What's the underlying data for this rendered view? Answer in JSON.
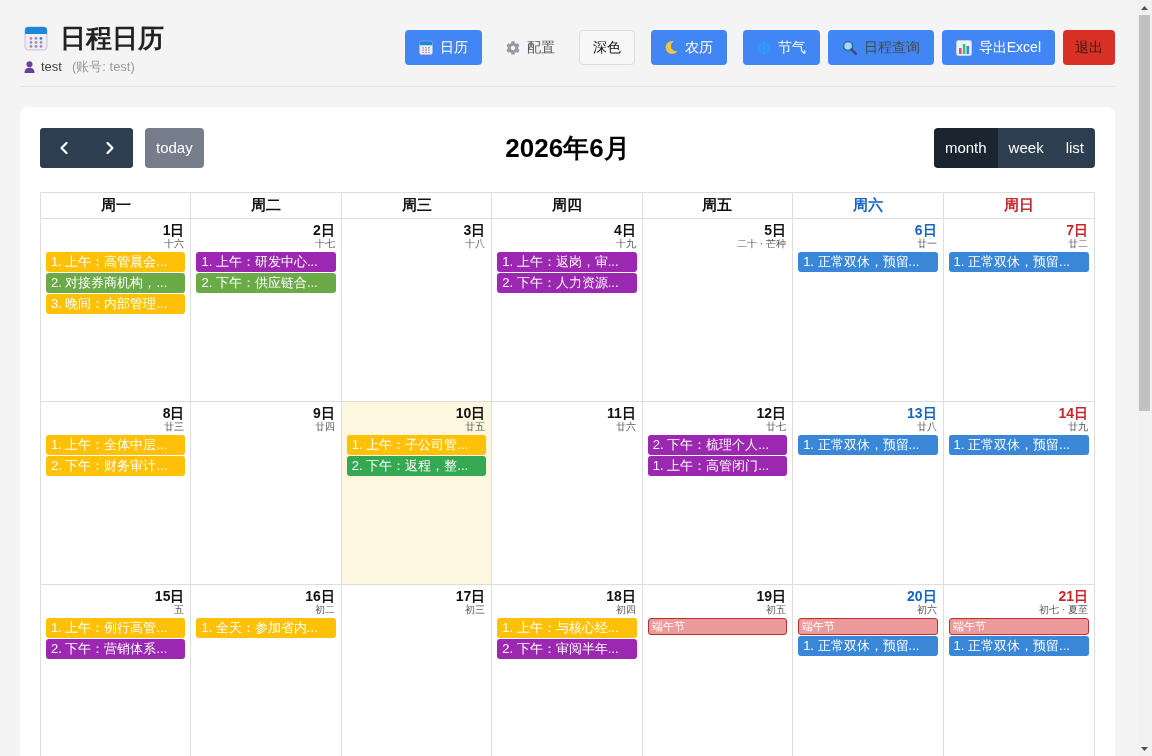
{
  "header": {
    "title": "日程日历",
    "user": "test",
    "account": "(账号: test)"
  },
  "toolbar_buttons": [
    {
      "label": "日历",
      "kind": "primary"
    },
    {
      "label": "配置",
      "kind": "plain"
    },
    {
      "label": "深色",
      "kind": "outline"
    },
    {
      "label": "农历",
      "kind": "primary"
    },
    {
      "label": "节气",
      "kind": "primary"
    },
    {
      "label": "日程查询",
      "kind": "muted"
    },
    {
      "label": "导出Excel",
      "kind": "primary"
    },
    {
      "label": "退出",
      "kind": "danger"
    }
  ],
  "calendar": {
    "today_button": "today",
    "title": "2026年6月",
    "views": [
      {
        "label": "month",
        "selected": true
      },
      {
        "label": "week",
        "selected": false
      },
      {
        "label": "list",
        "selected": false
      }
    ],
    "weekdays": [
      {
        "label": "周一",
        "kind": "weekday"
      },
      {
        "label": "周二",
        "kind": "weekday"
      },
      {
        "label": "周三",
        "kind": "weekday"
      },
      {
        "label": "周四",
        "kind": "weekday"
      },
      {
        "label": "周五",
        "kind": "weekday"
      },
      {
        "label": "周六",
        "kind": "saturday"
      },
      {
        "label": "周日",
        "kind": "sunday"
      }
    ],
    "weeks": [
      {
        "days": [
          {
            "date": "1日",
            "lunar": "十六",
            "kind": "weekday",
            "today": false,
            "events": [
              {
                "title": "1. 上午：高管晨会...",
                "kind": "event",
                "color": "#ffc107"
              },
              {
                "title": "2. 对接券商机构，...",
                "kind": "event",
                "color": "#6aaa47"
              },
              {
                "title": "3. 晚间：内部管理...",
                "kind": "event",
                "color": "#ffc107"
              }
            ]
          },
          {
            "date": "2日",
            "lunar": "十七",
            "kind": "weekday",
            "today": false,
            "events": [
              {
                "title": "1. 上午：研发中心...",
                "kind": "event",
                "color": "#9c27b0"
              },
              {
                "title": "2. 下午：供应链合...",
                "kind": "event",
                "color": "#6aaa47"
              }
            ]
          },
          {
            "date": "3日",
            "lunar": "十八",
            "kind": "weekday",
            "today": false
          },
          {
            "date": "4日",
            "lunar": "十九",
            "kind": "weekday",
            "today": false,
            "events": [
              {
                "title": "1. 上午：返岗，审...",
                "kind": "event",
                "color": "#9c27b0"
              },
              {
                "title": "2. 下午：人力资源...",
                "kind": "event",
                "color": "#9c27b0"
              }
            ]
          },
          {
            "date": "5日",
            "lunar": "二十 · 芒种",
            "kind": "weekday",
            "today": false
          },
          {
            "date": "6日",
            "lunar": "廿一",
            "kind": "saturday",
            "today": false,
            "events": [
              {
                "title": "1. 正常双休，预留...",
                "kind": "event",
                "color": "#3a87d8"
              }
            ]
          },
          {
            "date": "7日",
            "lunar": "廿二",
            "kind": "sunday",
            "today": false,
            "events": [
              {
                "title": "1. 正常双休，预留...",
                "kind": "event",
                "color": "#3a87d8"
              }
            ]
          }
        ]
      },
      {
        "days": [
          {
            "date": "8日",
            "lunar": "廿三",
            "kind": "weekday",
            "today": false,
            "events": [
              {
                "title": "1. 上午：全体中层...",
                "kind": "event",
                "color": "#ffc107"
              },
              {
                "title": "2. 下午：财务审计...",
                "kind": "event",
                "color": "#ffc107"
              }
            ]
          },
          {
            "date": "9日",
            "lunar": "廿四",
            "kind": "weekday",
            "today": false
          },
          {
            "date": "10日",
            "lunar": "廿五",
            "kind": "weekday",
            "today": true,
            "events": [
              {
                "title": "1. 上午：子公司管...",
                "kind": "event",
                "color": "#ffc107"
              },
              {
                "title": "2. 下午：返程，整...",
                "kind": "event",
                "color": "#34a853"
              }
            ]
          },
          {
            "date": "11日",
            "lunar": "廿六",
            "kind": "weekday",
            "today": false
          },
          {
            "date": "12日",
            "lunar": "廿七",
            "kind": "weekday",
            "today": false,
            "events": [
              {
                "title": "2. 下午：梳理个人...",
                "kind": "event",
                "color": "#9c27b0"
              },
              {
                "title": "1. 上午：高管闭门...",
                "kind": "event",
                "color": "#9c27b0"
              }
            ]
          },
          {
            "date": "13日",
            "lunar": "廿八",
            "kind": "saturday",
            "today": false,
            "events": [
              {
                "title": "1. 正常双休，预留...",
                "kind": "event",
                "color": "#3a87d8"
              }
            ]
          },
          {
            "date": "14日",
            "lunar": "廿九",
            "kind": "sunday",
            "today": false,
            "events": [
              {
                "title": "1. 正常双休，预留...",
                "kind": "event",
                "color": "#3a87d8"
              }
            ]
          }
        ]
      },
      {
        "days": [
          {
            "date": "15日",
            "lunar": "五",
            "kind": "weekday",
            "today": false,
            "events": [
              {
                "title": "1. 上午：例行高管...",
                "kind": "event",
                "color": "#ffc107"
              },
              {
                "title": "2. 下午：营销体系...",
                "kind": "event",
                "color": "#9c27b0"
              }
            ]
          },
          {
            "date": "16日",
            "lunar": "初二",
            "kind": "weekday",
            "today": false,
            "events": [
              {
                "title": "1. 全天：参加省内...",
                "kind": "event",
                "color": "#ffc107"
              }
            ]
          },
          {
            "date": "17日",
            "lunar": "初三",
            "kind": "weekday",
            "today": false
          },
          {
            "date": "18日",
            "lunar": "初四",
            "kind": "weekday",
            "today": false,
            "events": [
              {
                "title": "1. 上午：与核心经...",
                "kind": "event",
                "color": "#ffc107"
              },
              {
                "title": "2. 下午：审阅半年...",
                "kind": "event",
                "color": "#9c27b0"
              }
            ]
          },
          {
            "date": "19日",
            "lunar": "初五",
            "kind": "weekday",
            "today": false,
            "events": [
              {
                "title": "端午节",
                "kind": "holiday",
                "color": "#ec9a9a"
              }
            ]
          },
          {
            "date": "20日",
            "lunar": "初六",
            "kind": "saturday",
            "today": false,
            "events": [
              {
                "title": "端午节",
                "kind": "holiday",
                "color": "#ec9a9a"
              },
              {
                "title": "1. 正常双休，预留...",
                "kind": "event",
                "color": "#3a87d8"
              }
            ]
          },
          {
            "date": "21日",
            "lunar": "初七 · 夏至",
            "kind": "sunday",
            "today": false,
            "events": [
              {
                "title": "端午节",
                "kind": "holiday",
                "color": "#ec9a9a"
              },
              {
                "title": "1. 正常双休，预留...",
                "kind": "event",
                "color": "#3a87d8"
              }
            ]
          }
        ]
      }
    ]
  }
}
